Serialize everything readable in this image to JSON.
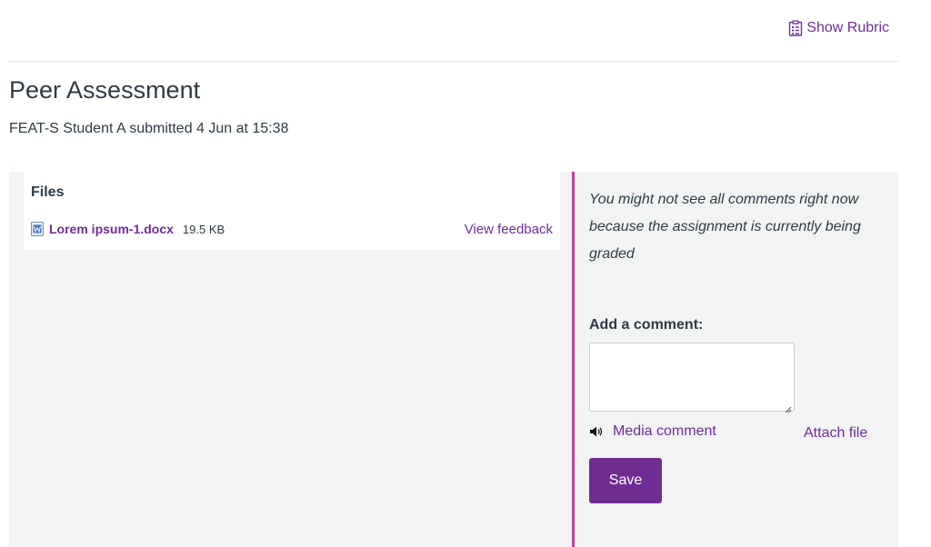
{
  "header": {
    "rubric_link": "Show Rubric",
    "rubric_icon": "clipboard-icon"
  },
  "page": {
    "title": "Peer Assessment",
    "submission_info": "FEAT-S Student A submitted 4 Jun at 15:38"
  },
  "files": {
    "title": "Files",
    "items": [
      {
        "icon": "word-document-icon",
        "name": "Lorem ipsum-1.docx",
        "size": "19.5 KB",
        "action": "View feedback"
      }
    ]
  },
  "comments": {
    "notice": "You might not see all comments right now because the assignment is currently being graded",
    "add_label": "Add a comment:",
    "comment_value": "",
    "media_comment": "Media comment",
    "media_icon": "speaker-icon",
    "attach_file": "Attach file",
    "save_label": "Save"
  },
  "colors": {
    "link": "#6f2d93",
    "divider": "#c6409d",
    "panel_bg": "#f2f3f3",
    "text": "#2d3b45"
  }
}
